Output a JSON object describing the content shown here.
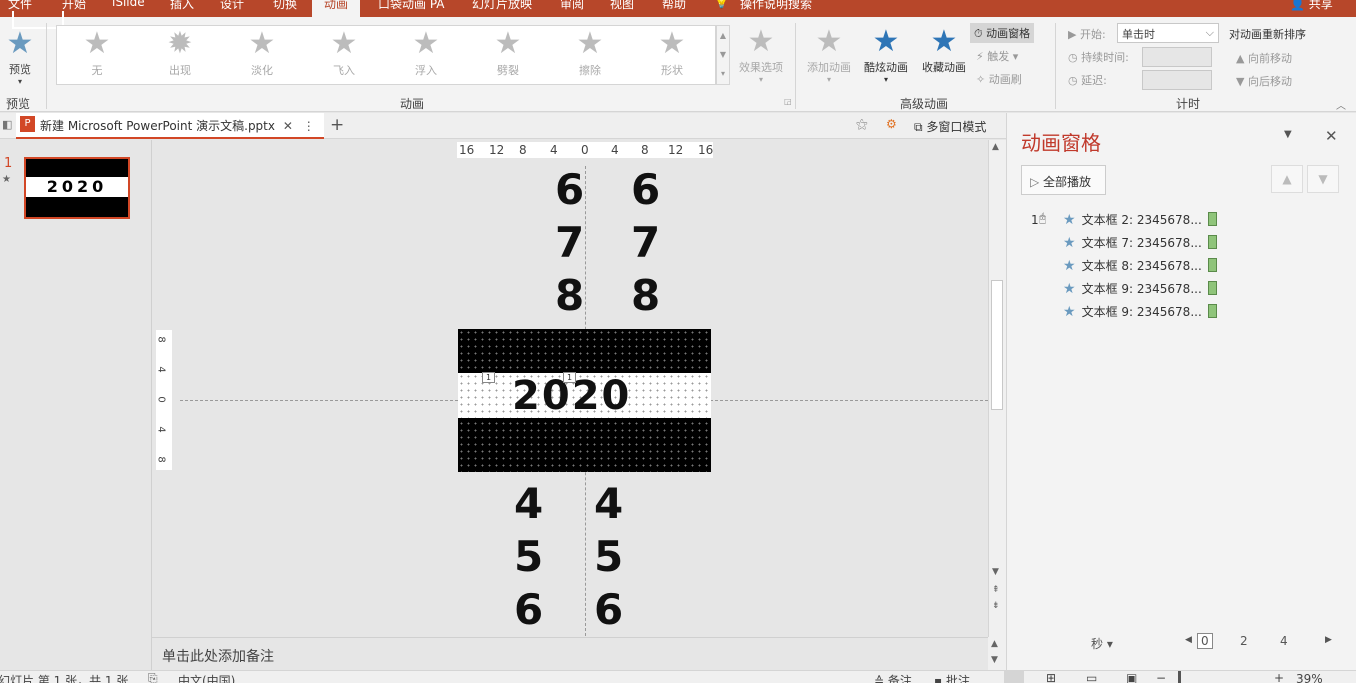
{
  "ribbon_tabs": [
    "文件",
    "开始",
    "iSlide",
    "插入",
    "设计",
    "切换",
    "动画",
    "口袋动画 PA",
    "幻灯片放映",
    "审阅",
    "视图",
    "帮助"
  ],
  "active_tab": "动画",
  "tell_me": "操作说明搜索",
  "share": "共享",
  "preview": {
    "label": "预览",
    "group": "预览"
  },
  "animations": {
    "group": "动画",
    "items": [
      "无",
      "出现",
      "淡化",
      "飞入",
      "浮入",
      "劈裂",
      "擦除",
      "形状"
    ],
    "effect_options": "效果选项"
  },
  "advanced": {
    "group": "高级动画",
    "add_animation": "添加动画",
    "cool_animation": "酷炫动画",
    "collect_animation": "收藏动画",
    "animation_pane": "动画窗格",
    "trigger": "触发",
    "painter": "动画刷"
  },
  "timing": {
    "group": "计时",
    "start_label": "开始:",
    "start_value": "单击时",
    "duration_label": "持续时间:",
    "delay_label": "延迟:",
    "reorder_title": "对动画重新排序",
    "move_earlier": "向前移动",
    "move_later": "向后移动"
  },
  "document_tab": {
    "title": "新建 Microsoft PowerPoint 演示文稿.pptx"
  },
  "multiwindow": "多窗口模式",
  "slide_number": "1",
  "thumb_text": "2020",
  "ruler_top": [
    "16",
    "12",
    "8",
    "4",
    "0",
    "4",
    "8",
    "12",
    "16"
  ],
  "ruler_left": [
    "8",
    "4",
    "0",
    "4",
    "8"
  ],
  "slide": {
    "top_left_digits": [
      "6",
      "7",
      "8"
    ],
    "top_right_digits": [
      "6",
      "7",
      "8"
    ],
    "bottom_left_digits": [
      "4",
      "5",
      "6"
    ],
    "bottom_right_digits": [
      "4",
      "5",
      "6"
    ],
    "center_text": [
      "2",
      "0",
      "2",
      "0"
    ],
    "tags": [
      "1",
      "1"
    ]
  },
  "notes_placeholder": "单击此处添加备注",
  "pane": {
    "title": "动画窗格",
    "play_all": "全部播放",
    "seq": "1",
    "items": [
      "文本框 2: 2345678...",
      "文本框 7: 2345678...",
      "文本框 8: 2345678...",
      "文本框 9: 2345678...",
      "文本框 9: 2345678..."
    ],
    "seconds": "秒",
    "timeline": [
      "0",
      "2",
      "4"
    ]
  },
  "status": {
    "slide_info": "幻灯片 第 1 张，共 1 张",
    "language": "中文(中国)",
    "notes": "备注",
    "comments": "批注",
    "zoom": "39%"
  },
  "colors": {
    "accent": "#b7472a",
    "pane_title": "#c0392b",
    "slide_bg": "#000000",
    "band": "#ffffff"
  }
}
